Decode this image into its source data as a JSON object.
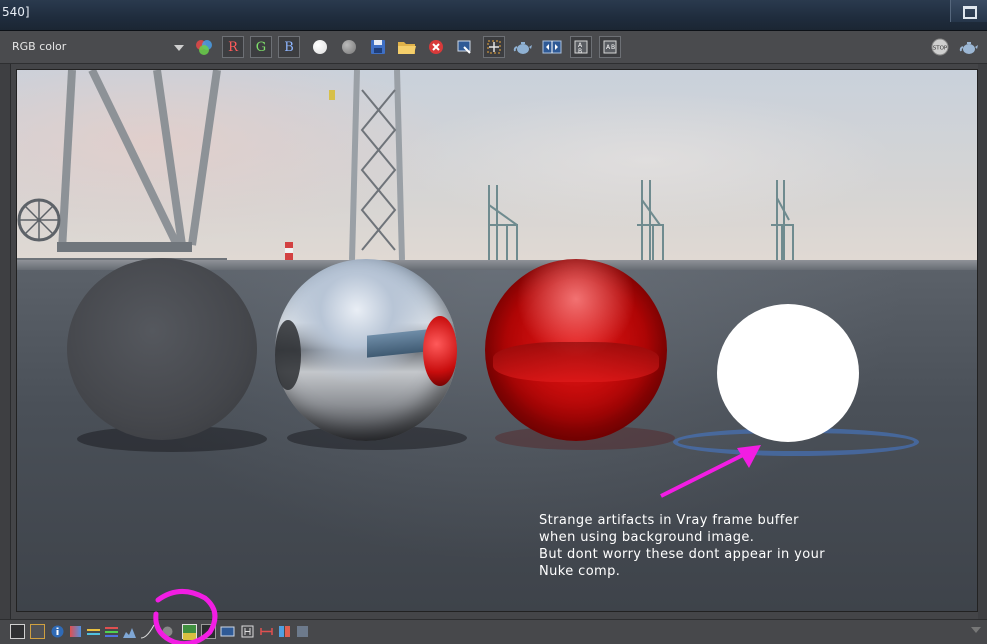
{
  "window": {
    "title_fragment": "540]"
  },
  "toolbar": {
    "channel_value": "RGB color",
    "channel_red_label": "R",
    "channel_green_label": "G",
    "channel_blue_label": "B",
    "stop_label": "STOP"
  },
  "annotation": {
    "line1": "Strange artifacts in Vray frame buffer",
    "line2": "when using background image.",
    "line3": "But dont worry these dont appear in your",
    "line4": "Nuke comp."
  },
  "colors": {
    "annotation_magenta": "#f21de3",
    "red_sphere": "#e51616",
    "window_bg": "#444548"
  },
  "icons": [
    "channels-icon",
    "white-dot-icon",
    "grey-dot-icon",
    "save-icon",
    "open-folder-icon",
    "clear-icon",
    "copy-to-history-icon",
    "region-render-icon",
    "teapot-render-icon",
    "compare-ab-icon",
    "ab-vertical-icon",
    "ab-horizontal-icon",
    "stop-icon",
    "teapot-icon"
  ]
}
